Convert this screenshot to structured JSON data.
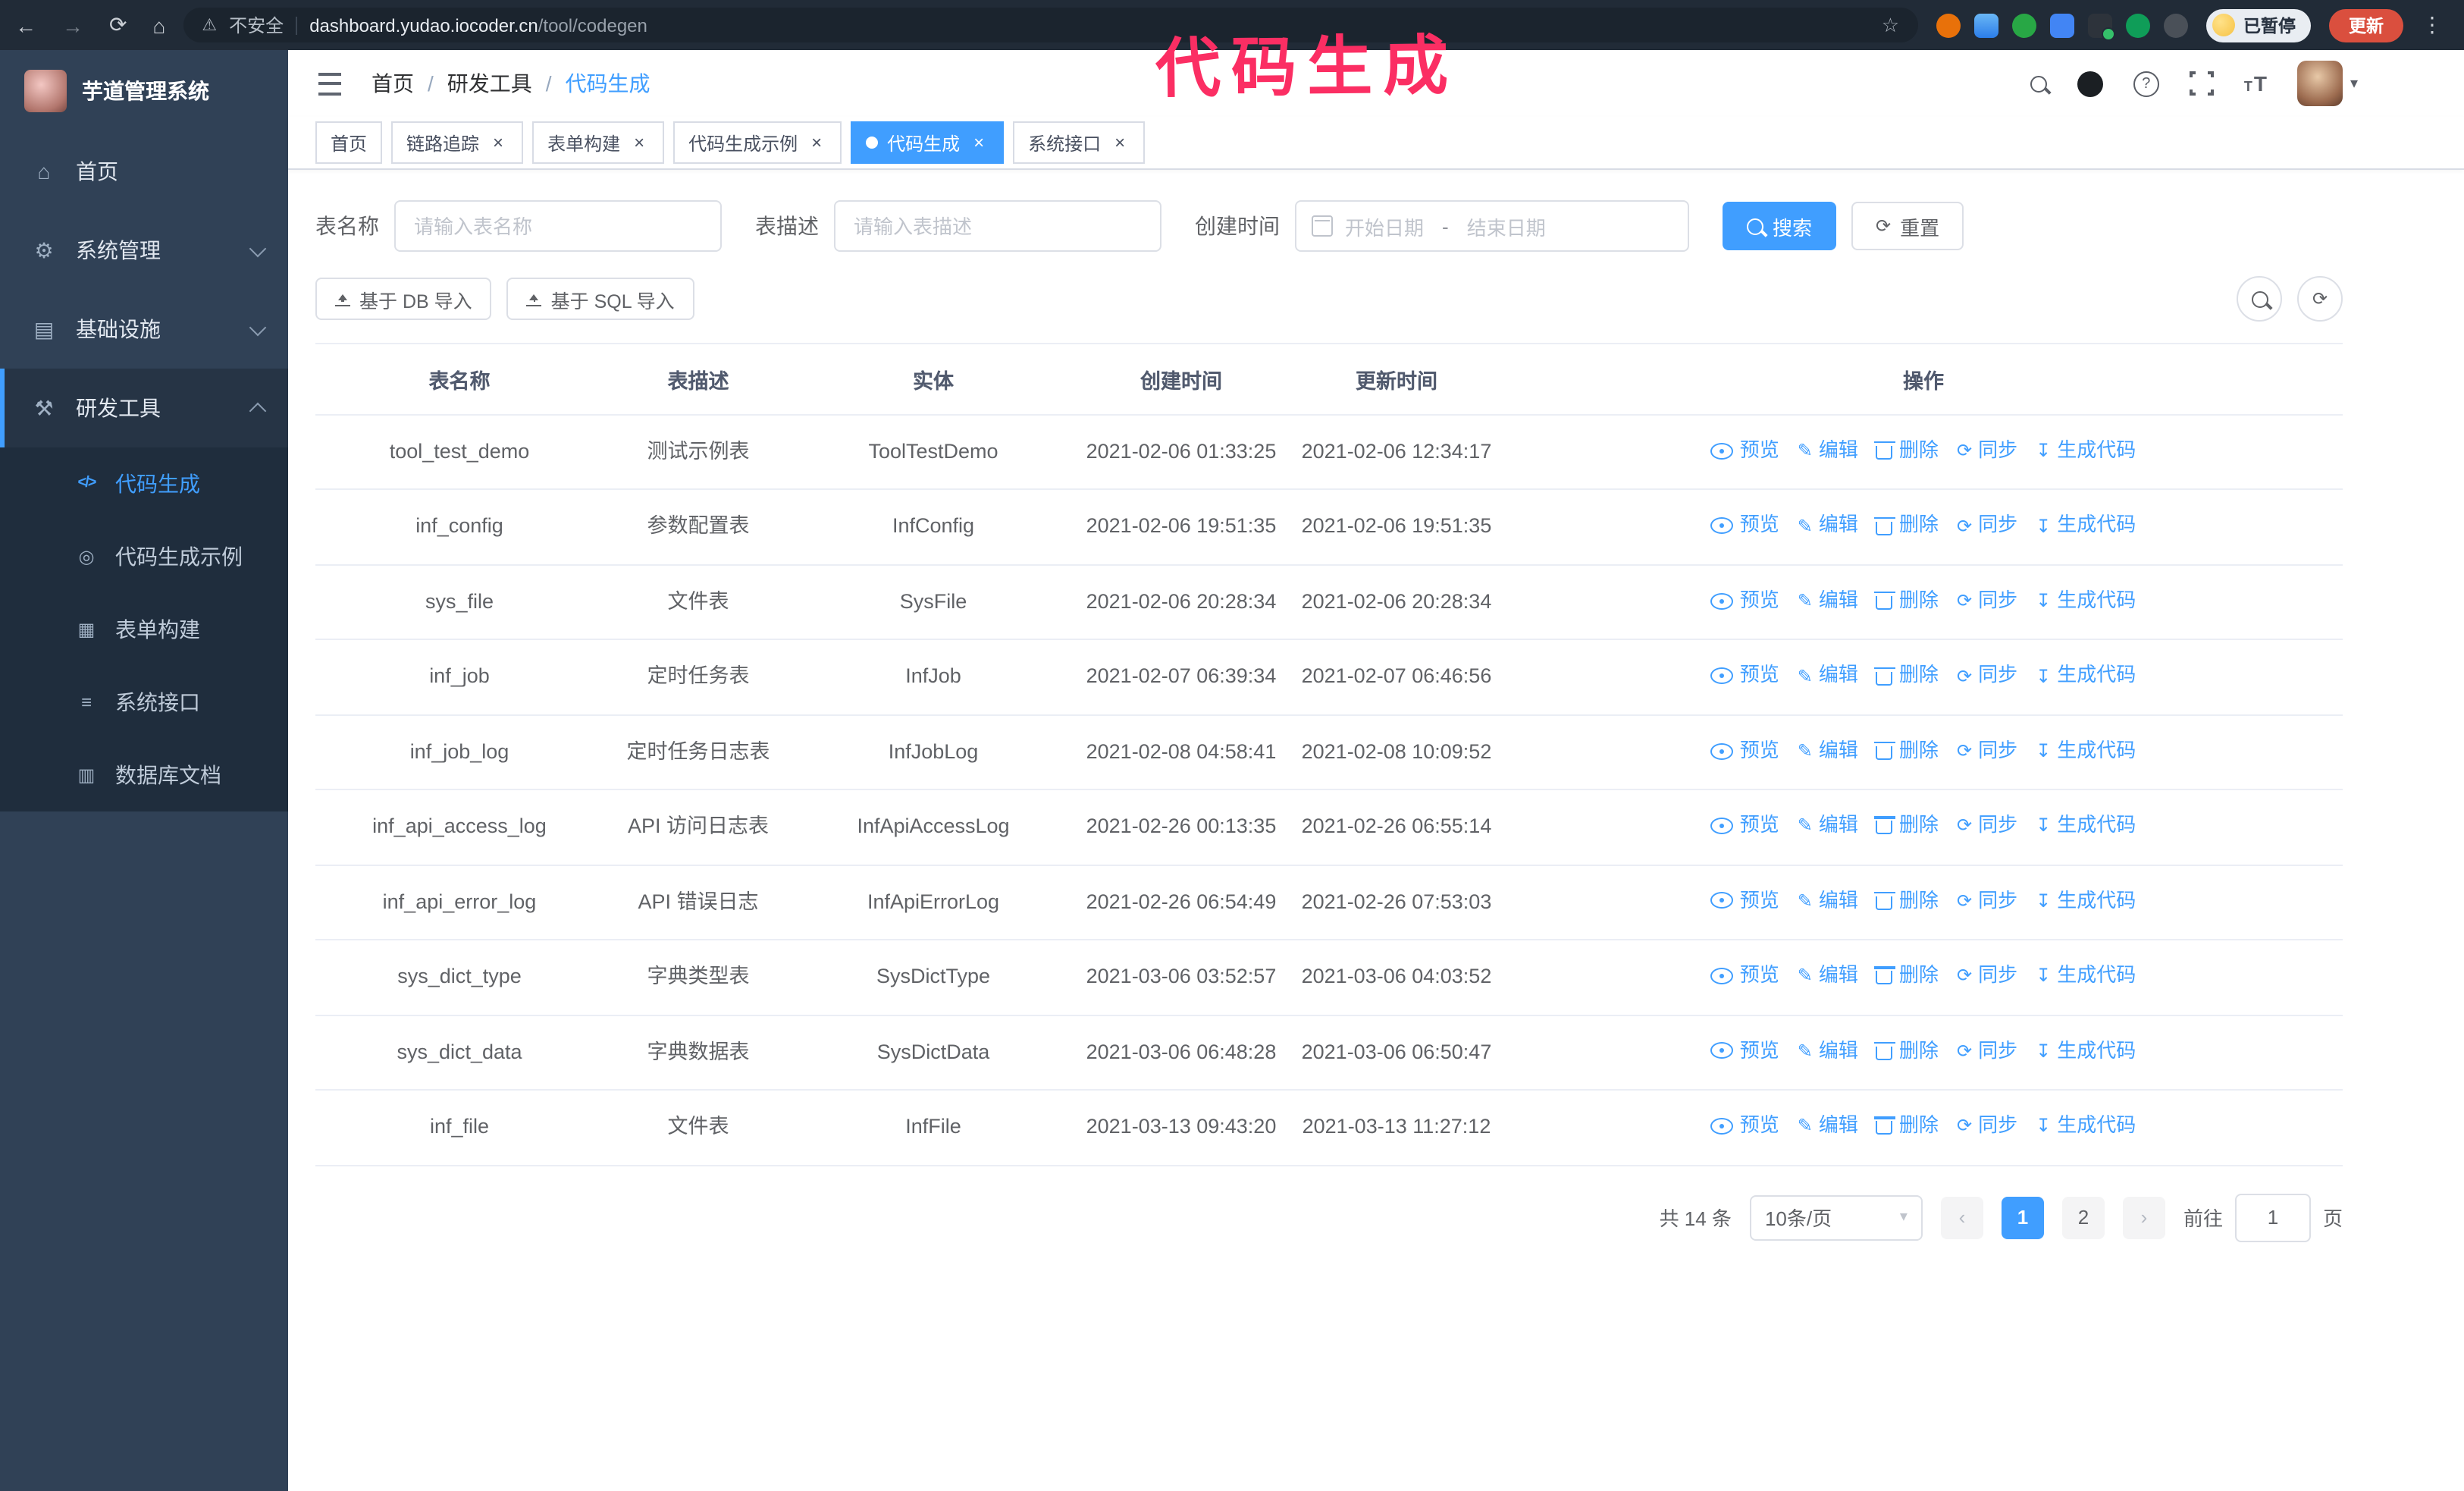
{
  "colors": {
    "accent": "#409eff",
    "annotation": "#fb2e63",
    "sidebar_bg": "#304156",
    "submenu_bg": "#1f2d3d",
    "update_button": "#da4f3e"
  },
  "annotation": {
    "text": "代码生成",
    "color": "#fb2e63"
  },
  "browser": {
    "security_label": "不安全",
    "url_domain": "dashboard.yudao.iocoder.cn",
    "url_path": "/tool/codegen",
    "paused_chip": "已暂停",
    "update_button": "更新"
  },
  "icons": {
    "back": "←",
    "forward": "→",
    "reload": "⟳",
    "home": "⌂",
    "warning": "⚠",
    "star": "☆",
    "kebab": "⋮",
    "menu_home": "⌂",
    "menu_system": "⚙",
    "menu_infra": "▤",
    "menu_tools": "⚒",
    "menu_code": "</>",
    "menu_example": "◎",
    "menu_form": "▦",
    "menu_api": "≡",
    "menu_db": "▥",
    "question": "?",
    "caret": "▾",
    "prev": "‹",
    "next": "›",
    "close": "×",
    "refresh": "⟳",
    "edit": "✎",
    "download": "↧",
    "font_small": "T",
    "font_large": "T"
  },
  "sidebar": {
    "app_title": "芋道管理系统",
    "menu": [
      {
        "label": "首页"
      },
      {
        "label": "系统管理"
      },
      {
        "label": "基础设施"
      },
      {
        "label": "研发工具"
      }
    ],
    "submenu": [
      {
        "label": "代码生成"
      },
      {
        "label": "代码生成示例"
      },
      {
        "label": "表单构建"
      },
      {
        "label": "系统接口"
      },
      {
        "label": "数据库文档"
      }
    ]
  },
  "header": {
    "breadcrumb": [
      "首页",
      "研发工具",
      "代码生成"
    ],
    "separator": "/"
  },
  "tabs": {
    "items": [
      {
        "label": "首页"
      },
      {
        "label": "链路追踪"
      },
      {
        "label": "表单构建"
      },
      {
        "label": "代码生成示例"
      },
      {
        "label": "代码生成"
      },
      {
        "label": "系统接口"
      }
    ]
  },
  "filters": {
    "name_label": "表名称",
    "name_placeholder": "请输入表名称",
    "desc_label": "表描述",
    "desc_placeholder": "请输入表描述",
    "time_label": "创建时间",
    "start_placeholder": "开始日期",
    "range_separator": "-",
    "end_placeholder": "结束日期",
    "search_button": "搜索",
    "reset_button": "重置"
  },
  "toolbar": {
    "import_db": "基于 DB 导入",
    "import_sql": "基于 SQL 导入"
  },
  "table": {
    "columns": [
      "表名称",
      "表描述",
      "实体",
      "创建时间",
      "更新时间",
      "操作"
    ],
    "action_labels": [
      "预览",
      "编辑",
      "删除",
      "同步",
      "生成代码"
    ],
    "rows": [
      {
        "name": "tool_test_demo",
        "desc": "测试示例表",
        "entity": "ToolTestDemo",
        "created": "2021-02-06 01:33:25",
        "updated": "2021-02-06 12:34:17"
      },
      {
        "name": "inf_config",
        "desc": "参数配置表",
        "entity": "InfConfig",
        "created": "2021-02-06 19:51:35",
        "updated": "2021-02-06 19:51:35"
      },
      {
        "name": "sys_file",
        "desc": "文件表",
        "entity": "SysFile",
        "created": "2021-02-06 20:28:34",
        "updated": "2021-02-06 20:28:34"
      },
      {
        "name": "inf_job",
        "desc": "定时任务表",
        "entity": "InfJob",
        "created": "2021-02-07 06:39:34",
        "updated": "2021-02-07 06:46:56"
      },
      {
        "name": "inf_job_log",
        "desc": "定时任务日志表",
        "entity": "InfJobLog",
        "created": "2021-02-08 04:58:41",
        "updated": "2021-02-08 10:09:52"
      },
      {
        "name": "inf_api_access_log",
        "desc": "API 访问日志表",
        "entity": "InfApiAccessLog",
        "created": "2021-02-26 00:13:35",
        "updated": "2021-02-26 06:55:14"
      },
      {
        "name": "inf_api_error_log",
        "desc": "API 错误日志",
        "entity": "InfApiErrorLog",
        "created": "2021-02-26 06:54:49",
        "updated": "2021-02-26 07:53:03"
      },
      {
        "name": "sys_dict_type",
        "desc": "字典类型表",
        "entity": "SysDictType",
        "created": "2021-03-06 03:52:57",
        "updated": "2021-03-06 04:03:52"
      },
      {
        "name": "sys_dict_data",
        "desc": "字典数据表",
        "entity": "SysDictData",
        "created": "2021-03-06 06:48:28",
        "updated": "2021-03-06 06:50:47"
      },
      {
        "name": "inf_file",
        "desc": "文件表",
        "entity": "InfFile",
        "created": "2021-03-13 09:43:20",
        "updated": "2021-03-13 11:27:12"
      }
    ]
  },
  "pagination": {
    "total": "共 14 条",
    "page_size": "10条/页",
    "pages": [
      "1",
      "2"
    ],
    "goto_label": "前往",
    "goto_value": "1",
    "goto_suffix": "页"
  }
}
